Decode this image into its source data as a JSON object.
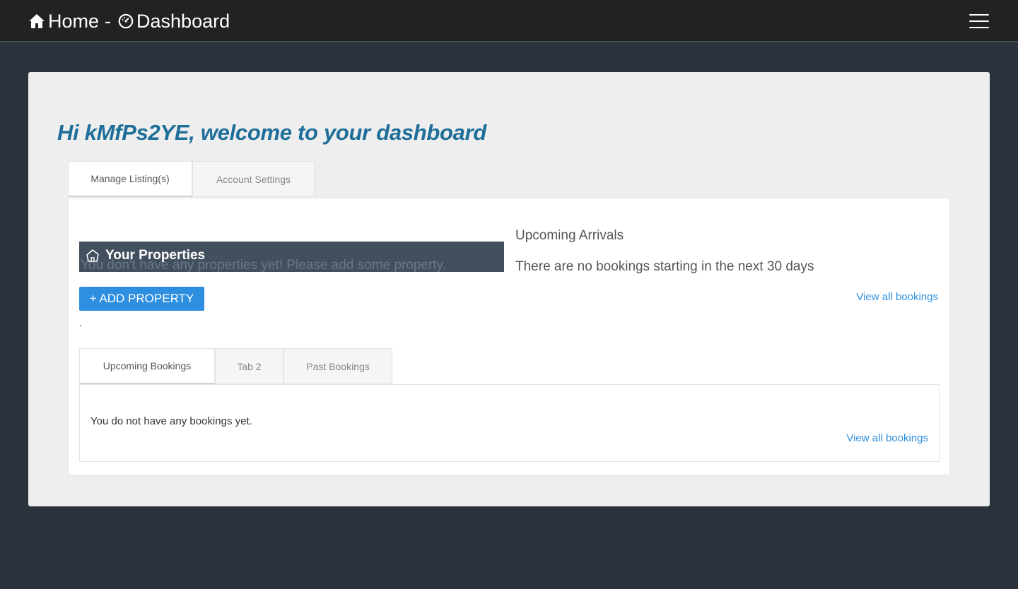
{
  "nav": {
    "home_label": "Home",
    "separator": "-",
    "dashboard_label": "Dashboard"
  },
  "welcome": "Hi kMfPs2YE, welcome to your dashboard",
  "tabs": [
    {
      "label": "Manage Listing(s)",
      "active": true
    },
    {
      "label": "Account Settings",
      "active": false
    }
  ],
  "properties": {
    "title": "Your Properties",
    "empty_message": "You don't have any properties yet! Please add some property.",
    "add_button": "+ ADD PROPERTY",
    "dot": "."
  },
  "arrivals": {
    "title": "Upcoming Arrivals",
    "message": "There are no bookings starting in the next 30 days",
    "link": "View all bookings"
  },
  "booking_tabs": [
    {
      "label": "Upcoming Bookings",
      "active": true
    },
    {
      "label": "Tab 2",
      "active": false
    },
    {
      "label": "Past Bookings",
      "active": false
    }
  ],
  "bookings": {
    "empty_message": "You do not have any bookings yet.",
    "link": "View all bookings"
  },
  "colors": {
    "accent": "#2e8fe0",
    "welcome": "#1e6e99",
    "navbar": "#222222",
    "page_bg": "#2a333b"
  }
}
